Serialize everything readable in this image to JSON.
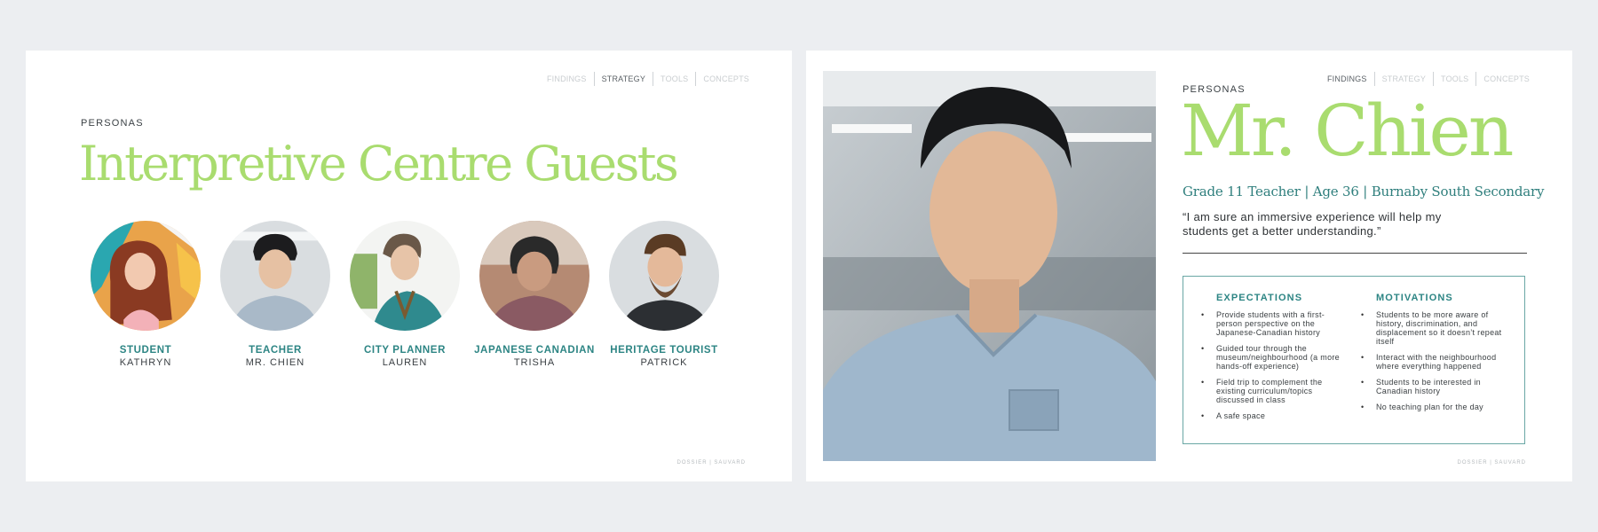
{
  "nav": [
    "FINDINGS",
    "STRATEGY",
    "TOOLS",
    "CONCEPTS"
  ],
  "footer": "DOSSIER | SAUVARD",
  "left_slide": {
    "nav_active": "STRATEGY",
    "section": "PERSONAS",
    "title": "Interpretive Centre Guests",
    "personas": [
      {
        "role": "STUDENT",
        "name": "KATHRYN"
      },
      {
        "role": "TEACHER",
        "name": "MR. CHIEN"
      },
      {
        "role": "CITY PLANNER",
        "name": "LAUREN"
      },
      {
        "role": "JAPANESE CANADIAN",
        "name": "TRISHA"
      },
      {
        "role": "HERITAGE TOURIST",
        "name": "PATRICK"
      }
    ]
  },
  "right_slide": {
    "nav_active": "FINDINGS",
    "section": "PERSONAS",
    "title": "Mr. Chien",
    "subtitle": "Grade 11 Teacher | Age 36 | Burnaby South Secondary",
    "quote": "“I am sure an immersive experience will help my students get a better understanding.”",
    "expectations": {
      "heading": "EXPECTATIONS",
      "items": [
        "Provide students with a first-person perspective on the Japanese-Canadian history",
        "Guided tour through the museum/neighbourhood (a more hands-off experience)",
        "Field trip to complement the existing curriculum/topics discussed in class",
        "A safe space"
      ]
    },
    "motivations": {
      "heading": "MOTIVATIONS",
      "items": [
        "Students to be more aware of history, discrimination, and displacement so it doesn’t repeat itself",
        "Interact with the neighbourhood where everything happened",
        "Students to be interested in Canadian history",
        "No teaching plan for the day"
      ]
    }
  },
  "colors": {
    "accent_green": "#a9dc6f",
    "teal": "#2d8584",
    "background": "#eceef1"
  }
}
